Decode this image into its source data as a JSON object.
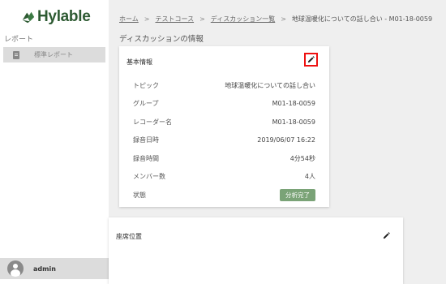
{
  "brand": {
    "name": "Hylable",
    "color": "#2d5a32"
  },
  "sidebar": {
    "section_label": "レポート",
    "items": [
      {
        "label": "標準レポート",
        "icon": "clipboard-icon"
      }
    ],
    "user": {
      "name": "admin",
      "icon": "user-avatar-icon"
    }
  },
  "breadcrumb": [
    {
      "label": "ホーム",
      "link": true
    },
    {
      "label": "テストコース",
      "link": true
    },
    {
      "label": "ディスカッション一覧",
      "link": true
    },
    {
      "label": "地球温暖化についての話し合い - M01-18-0059",
      "link": false
    }
  ],
  "breadcrumb_separator": ">",
  "page_title": "ディスカッションの情報",
  "info_card": {
    "title": "基本情報",
    "edit_icon": "pencil-icon",
    "highlight_color": "#ee1111",
    "rows": [
      {
        "key": "トピック",
        "value": "地球温暖化についての話し合い"
      },
      {
        "key": "グループ",
        "value": "M01-18-0059"
      },
      {
        "key": "レコーダー名",
        "value": "M01-18-0059"
      },
      {
        "key": "録音日時",
        "value": "2019/06/07 16:22"
      },
      {
        "key": "録音時間",
        "value": "4分54秒"
      },
      {
        "key": "メンバー数",
        "value": "4人"
      }
    ],
    "status": {
      "key": "状態",
      "value": "分析完了",
      "color": "#7aa377"
    }
  },
  "seat_card": {
    "title": "座席位置",
    "edit_icon": "pencil-icon"
  }
}
